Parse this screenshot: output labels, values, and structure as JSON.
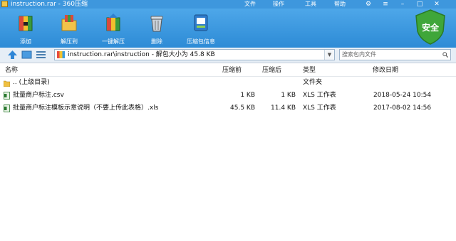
{
  "window": {
    "title": "instruction.rar - 360压缩"
  },
  "menu": {
    "file": "文件",
    "operate": "操作",
    "tools": "工具",
    "help": "帮助"
  },
  "toolbar": {
    "add": "添加",
    "extract_to": "解压到",
    "one_click_extract": "一键解压",
    "delete": "删除",
    "info": "压缩包信息"
  },
  "security": {
    "label": "安全"
  },
  "nav": {
    "path": "instruction.rar\\instruction - 解包大小为 45.8 KB",
    "search_placeholder": "搜索包内文件"
  },
  "columns": {
    "name": "名称",
    "packed": "压缩前",
    "compressed": "压缩后",
    "type": "类型",
    "modified": "修改日期"
  },
  "rows": [
    {
      "name": ".. (上级目录)",
      "packed": "",
      "compressed": "",
      "type": "文件夹",
      "modified": "",
      "icon": "folder-up-icon"
    },
    {
      "name": "批量商户标注.csv",
      "packed": "1 KB",
      "compressed": "1 KB",
      "type": "XLS 工作表",
      "modified": "2018-05-24 10:54",
      "icon": "excel-file-icon"
    },
    {
      "name": "批量商户标注模板示意说明（不要上传此表格）.xls",
      "packed": "45.5 KB",
      "compressed": "11.4 KB",
      "type": "XLS 工作表",
      "modified": "2017-08-02 14:56",
      "icon": "excel-file-icon"
    }
  ]
}
